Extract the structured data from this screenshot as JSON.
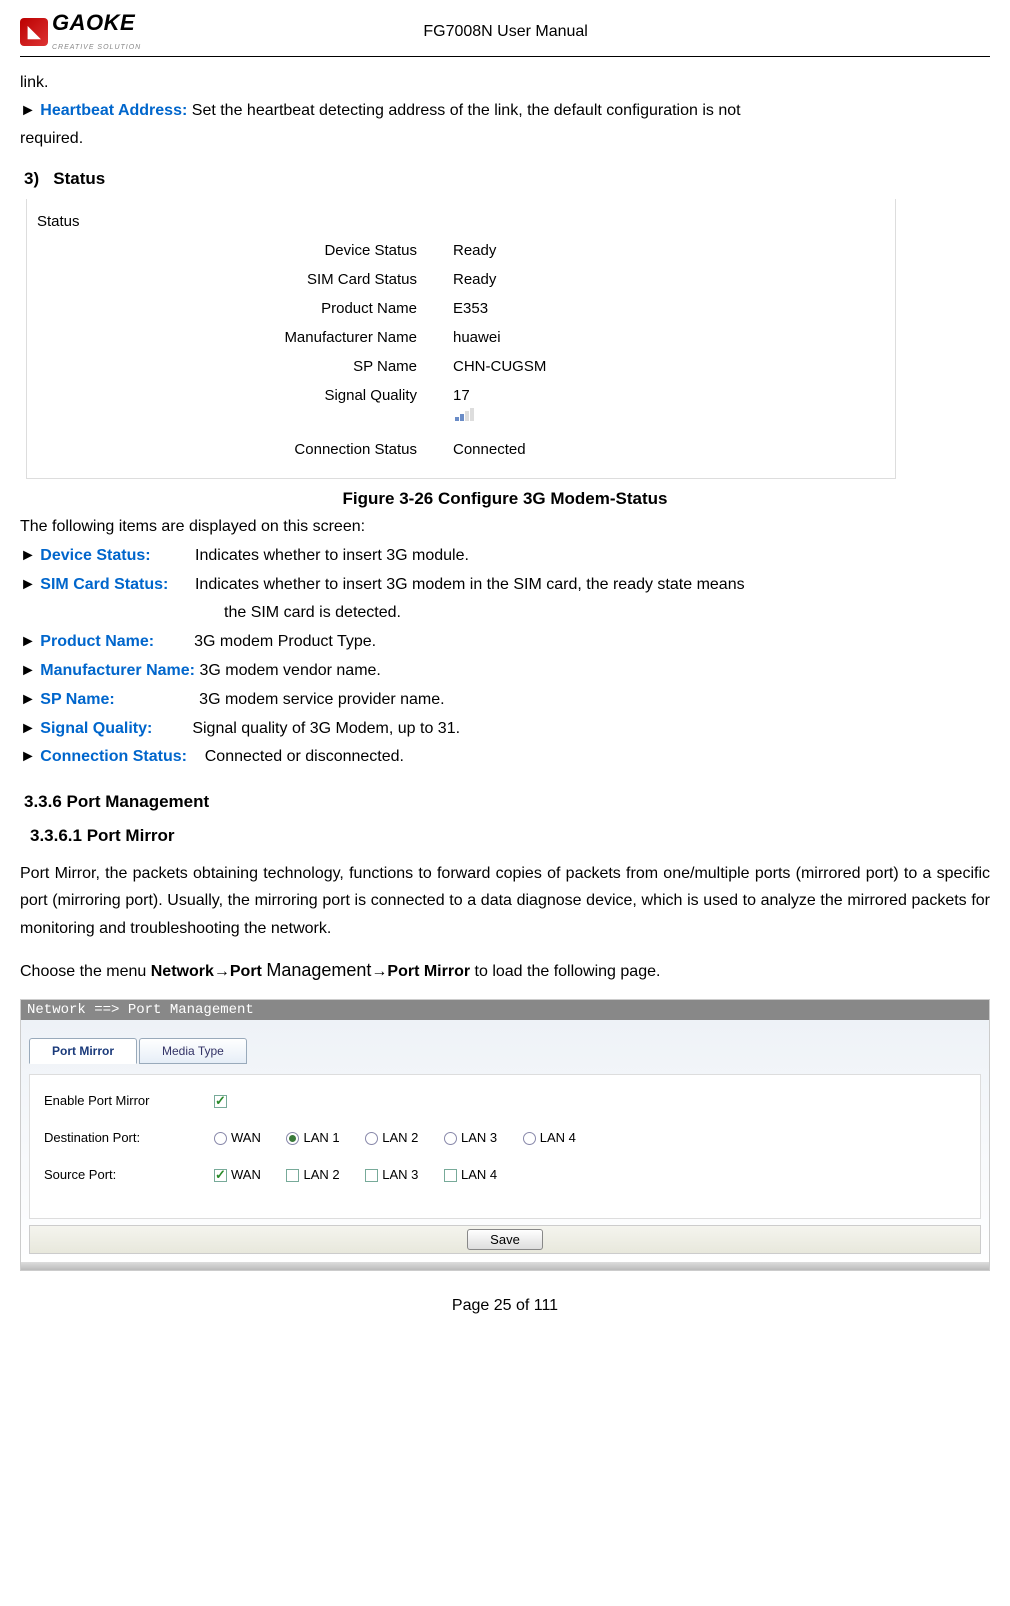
{
  "header": {
    "logo_main": "GAOKE",
    "logo_sub": "CREATIVE SOLUTION",
    "doc_title": "FG7008N User Manual"
  },
  "intro": {
    "link_cont": "link.",
    "heartbeat_label": "Heartbeat Address:",
    "heartbeat_desc": "Set the heartbeat detecting address of the link, the default configuration is not",
    "heartbeat_cont": "required."
  },
  "status_section": {
    "num": "3)",
    "title": "Status",
    "box_title": "Status",
    "rows": [
      {
        "label": "Device Status",
        "value": "Ready"
      },
      {
        "label": "SIM Card Status",
        "value": "Ready"
      },
      {
        "label": "Product Name",
        "value": "E353"
      },
      {
        "label": "Manufacturer Name",
        "value": "huawei"
      },
      {
        "label": "SP Name",
        "value": "CHN-CUGSM"
      },
      {
        "label": "Signal Quality",
        "value": "17"
      },
      {
        "label": "Connection Status",
        "value": "Connected"
      }
    ],
    "caption": "Figure 3-26  Configure 3G Modem-Status",
    "following": "The following items are displayed on this screen:",
    "defs": {
      "device_status": {
        "k": "Device Status:",
        "v": "Indicates whether to insert 3G module."
      },
      "sim": {
        "k": "SIM Card Status:",
        "v": "Indicates whether to insert 3G modem in the SIM card, the ready state means",
        "v2": "the SIM card is detected."
      },
      "product": {
        "k": "Product Name:",
        "v": "3G modem Product Type."
      },
      "manufacturer": {
        "k": "Manufacturer Name:",
        "v": "3G modem vendor name."
      },
      "sp": {
        "k": "SP Name:",
        "v": "3G modem service provider name."
      },
      "signal": {
        "k": "Signal Quality:",
        "v": "Signal quality of 3G Modem, up to 31."
      },
      "conn": {
        "k": "Connection Status:",
        "v": "Connected or disconnected."
      }
    }
  },
  "pm": {
    "h336": "3.3.6    Port Management",
    "h3361": "3.3.6.1      Port Mirror",
    "para": "Port Mirror, the packets obtaining technology, functions to forward copies of packets from one/multiple ports (mirrored port) to a specific port (mirroring port). Usually, the mirroring port is connected to a data diagnose device, which is used to analyze the mirrored packets for monitoring and troubleshooting the network.",
    "nav_pre": "Choose the menu ",
    "nav_b1": "Network",
    "nav_arrow1": "→",
    "nav_b2": "Port ",
    "nav_m": "Management",
    "nav_arrow2": "→",
    "nav_b3": "Port Mirror",
    "nav_post": " to load the following page.",
    "titlebar": "Network ==> Port Management",
    "tabs": {
      "t1": "Port Mirror",
      "t2": "Media Type"
    },
    "rows": {
      "enable": "Enable Port Mirror",
      "dest": "Destination Port:",
      "src": "Source Port:",
      "dest_opts": [
        "WAN",
        "LAN 1",
        "LAN 2",
        "LAN 3",
        "LAN 4"
      ],
      "src_opts": [
        "WAN",
        "LAN 2",
        "LAN 3",
        "LAN 4"
      ]
    },
    "save": "Save"
  },
  "footer": {
    "page": "Page 25 of 111"
  }
}
